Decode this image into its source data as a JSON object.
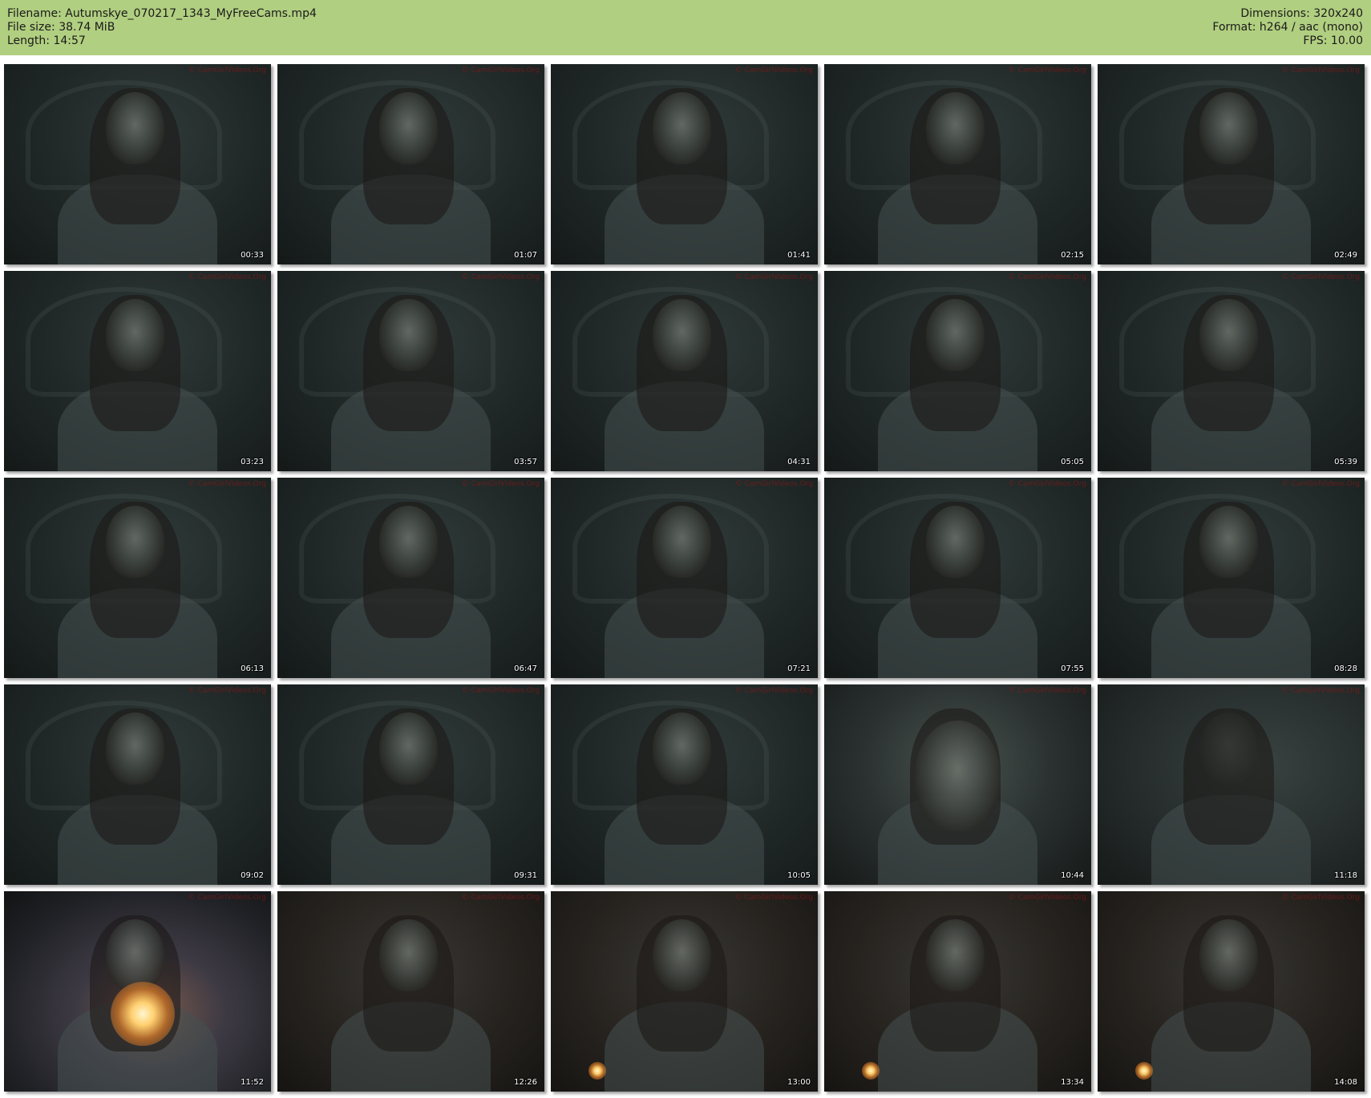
{
  "header": {
    "filename": "Filename: Autumskye_070217_1343_MyFreeCams.mp4",
    "filesize": "File size: 38.74 MiB",
    "length": "Length: 14:57",
    "dimensions": "Dimensions: 320x240",
    "format": "Format: h264 / aac (mono)",
    "fps": "FPS: 10.00"
  },
  "watermark": "© CamGirlVideos.Org",
  "thumbnails": [
    {
      "time": "00:33",
      "scene": "dark"
    },
    {
      "time": "01:07",
      "scene": "dark"
    },
    {
      "time": "01:41",
      "scene": "dark"
    },
    {
      "time": "02:15",
      "scene": "dark"
    },
    {
      "time": "02:49",
      "scene": "dark"
    },
    {
      "time": "03:23",
      "scene": "dark"
    },
    {
      "time": "03:57",
      "scene": "dark"
    },
    {
      "time": "04:31",
      "scene": "dark"
    },
    {
      "time": "05:05",
      "scene": "dark"
    },
    {
      "time": "05:39",
      "scene": "dark"
    },
    {
      "time": "06:13",
      "scene": "dark"
    },
    {
      "time": "06:47",
      "scene": "dark"
    },
    {
      "time": "07:21",
      "scene": "dark"
    },
    {
      "time": "07:55",
      "scene": "dark"
    },
    {
      "time": "08:28",
      "scene": "dark"
    },
    {
      "time": "09:02",
      "scene": "dark"
    },
    {
      "time": "09:31",
      "scene": "dark"
    },
    {
      "time": "10:05",
      "scene": "dark"
    },
    {
      "time": "10:44",
      "scene": "close"
    },
    {
      "time": "11:18",
      "scene": "blur"
    },
    {
      "time": "11:52",
      "scene": "candle"
    },
    {
      "time": "12:26",
      "scene": "warm"
    },
    {
      "time": "13:00",
      "scene": "warm"
    },
    {
      "time": "13:34",
      "scene": "warm"
    },
    {
      "time": "14:08",
      "scene": "warm"
    }
  ]
}
